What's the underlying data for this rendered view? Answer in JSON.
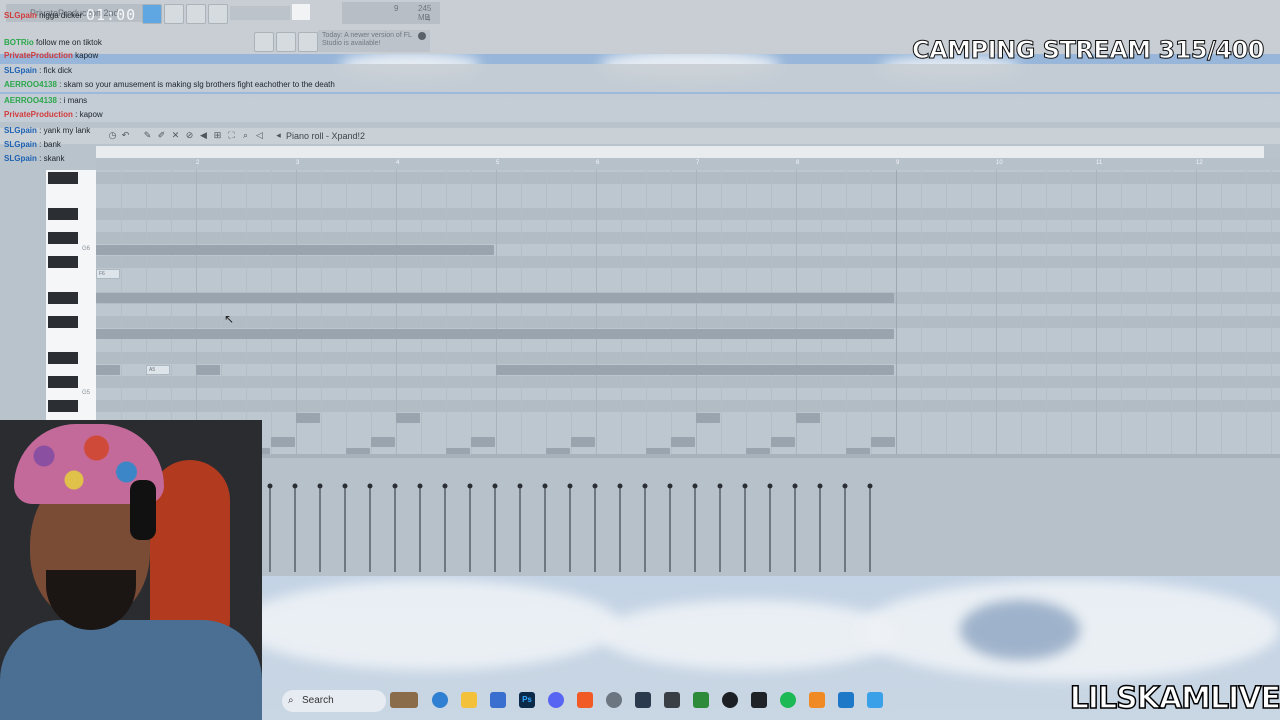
{
  "fl_studio": {
    "time_display": "01:00",
    "cpu_readout": [
      "9",
      "245 MB",
      "4"
    ],
    "update_hint": "Today: A newer version of FL Studio is available!",
    "menu_label": "PrivateProduction 2nd"
  },
  "chat": [
    {
      "user": "SLGpain",
      "text": "nigga dicker"
    },
    {
      "user": "BOTRio",
      "text": "follow me on tiktok"
    },
    {
      "user": "PrivateProduction",
      "text": "kapow"
    },
    {
      "user": "SLGpain",
      "text": "fick dick"
    },
    {
      "user": "AERROO4138",
      "text": "skam so your amusement is making slg brothers fight eachother to the death"
    },
    {
      "user": "AERROO4138",
      "text": "i mans"
    },
    {
      "user": "PrivateProduction",
      "text": "kapow"
    },
    {
      "user": "SLGpain",
      "text": "yank my lank"
    },
    {
      "user": "SLGpain",
      "text": "bank"
    },
    {
      "user": "SLGpain",
      "text": "skank"
    }
  ],
  "stream_title": "CAMPING STREAM 315/400",
  "brand": "LILSKAMLIVE",
  "piano_roll": {
    "title": "Piano roll - Xpand!2",
    "ruler_numbers": [
      "2",
      "3",
      "4",
      "5",
      "6",
      "7",
      "8",
      "9",
      "10",
      "11",
      "12"
    ],
    "key_labels": [
      "G6",
      "G5"
    ],
    "note_labels": [
      "F6",
      "A5"
    ]
  },
  "taskbar": {
    "search_label": "Search",
    "icons": [
      "widgets-icon",
      "edge-icon",
      "file-explorer-icon",
      "store-icon",
      "photoshop-icon",
      "discord-icon",
      "brave-icon",
      "chrome-icon",
      "steam-icon",
      "keyboard-icon",
      "game-icon",
      "music-icon",
      "terminal-icon",
      "spotify-icon",
      "fl-studio-icon",
      "paint-icon",
      "notepad-icon"
    ]
  },
  "colors": {
    "accent": "#5ea7e3",
    "note": "#99a4ae",
    "grid": "#bdc7cf"
  }
}
